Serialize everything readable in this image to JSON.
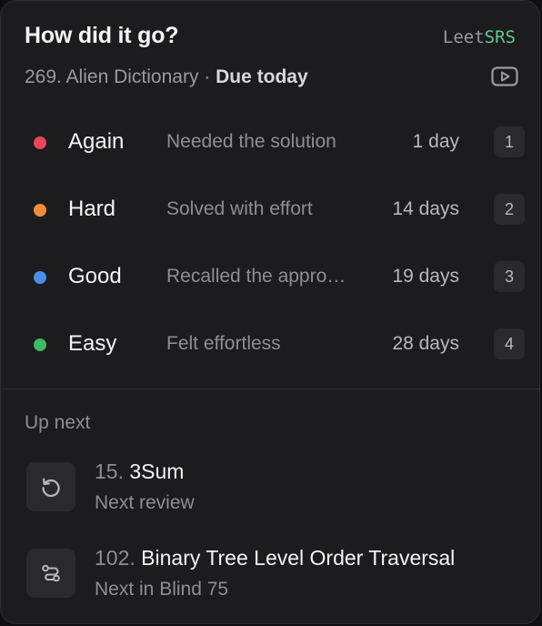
{
  "header": {
    "title": "How did it go?",
    "brand_prefix": "Leet",
    "brand_accent": "SRS",
    "brand_accent_color": "#5fc98a"
  },
  "problem": {
    "label": "269. Alien Dictionary",
    "separator": "·",
    "due": "Due today",
    "video_icon": "play-video-icon"
  },
  "ratings": [
    {
      "label": "Again",
      "desc": "Needed the solution",
      "interval": "1 day",
      "key": "1",
      "color": "#e5475c"
    },
    {
      "label": "Hard",
      "desc": "Solved with effort",
      "interval": "14 days",
      "key": "2",
      "color": "#ee8d3a"
    },
    {
      "label": "Good",
      "desc": "Recalled the appro…",
      "interval": "19 days",
      "key": "3",
      "color": "#4b8ce8"
    },
    {
      "label": "Easy",
      "desc": "Felt effortless",
      "interval": "28 days",
      "key": "4",
      "color": "#3fb763"
    }
  ],
  "up_next": {
    "title": "Up next",
    "items": [
      {
        "number": "15.",
        "name": "3Sum",
        "meta": "Next review",
        "icon": "review-cycle-icon"
      },
      {
        "number": "102.",
        "name": "Binary Tree Level Order Traversal",
        "meta": "Next in Blind 75",
        "icon": "list-path-icon"
      }
    ]
  }
}
